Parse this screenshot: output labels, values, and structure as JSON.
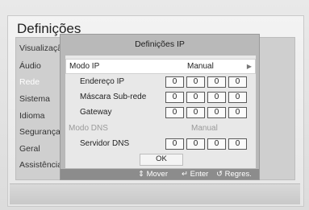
{
  "page": {
    "title": "Definições"
  },
  "sidebar": {
    "items": [
      {
        "label": "Visualização"
      },
      {
        "label": "Áudio"
      },
      {
        "label": "Rede"
      },
      {
        "label": "Sistema"
      },
      {
        "label": "Idioma"
      },
      {
        "label": "Segurança"
      },
      {
        "label": "Geral"
      },
      {
        "label": "Assistência"
      }
    ],
    "active_index": 2
  },
  "dialog": {
    "title": "Definições IP",
    "ip_mode": {
      "label": "Modo IP",
      "value": "Manual"
    },
    "ip_address": {
      "label": "Endereço IP",
      "octets": [
        "0",
        "0",
        "0",
        "0"
      ]
    },
    "subnet_mask": {
      "label": "Máscara Sub-rede",
      "octets": [
        "0",
        "0",
        "0",
        "0"
      ]
    },
    "gateway": {
      "label": "Gateway",
      "octets": [
        "0",
        "0",
        "0",
        "0"
      ]
    },
    "dns_mode": {
      "label": "Modo DNS",
      "value": "Manual"
    },
    "dns_server": {
      "label": "Servidor DNS",
      "octets": [
        "0",
        "0",
        "0",
        "0"
      ]
    },
    "ok_label": "OK",
    "footer": {
      "move": "Mover",
      "enter": "Enter",
      "back": "Regres."
    }
  },
  "icons": {
    "move": "up-down-arrows-icon",
    "enter": "enter-icon",
    "back": "return-icon",
    "chevron": "chevron-right-icon"
  }
}
